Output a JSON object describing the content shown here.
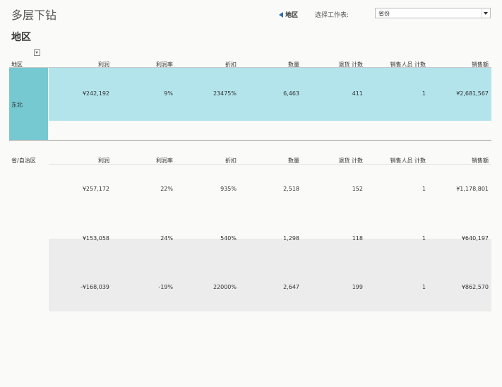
{
  "title": "多层下钻",
  "back_button_label": "地区",
  "sheet_selector": {
    "label": "选择工作表:",
    "value": "省份"
  },
  "section_title": "地区",
  "top_table": {
    "row_header": "地区",
    "columns": [
      "利润",
      "利润率",
      "折扣",
      "数量",
      "退货 计数",
      "销售人员 计数",
      "销售额"
    ],
    "rows": [
      {
        "region": "东北",
        "values": [
          "¥242,192",
          "9%",
          "23475%",
          "6,463",
          "411",
          "1",
          "¥2,681,567"
        ]
      }
    ]
  },
  "bottom_table": {
    "row_header": "省/自治区",
    "columns": [
      "利润",
      "利润率",
      "折扣",
      "数量",
      "退货 计数",
      "销售人员 计数",
      "销售额"
    ],
    "rows": [
      {
        "values": [
          "¥257,172",
          "22%",
          "935%",
          "2,518",
          "152",
          "1",
          "¥1,178,801"
        ]
      },
      {
        "values": [
          "¥153,058",
          "24%",
          "540%",
          "1,298",
          "118",
          "1",
          "¥640,197"
        ]
      },
      {
        "values": [
          "-¥168,039",
          "-19%",
          "22000%",
          "2,647",
          "199",
          "1",
          "¥862,570"
        ]
      }
    ]
  },
  "colors": {
    "selected_row": "#b3e4ec",
    "selected_header": "#76c9d1",
    "accent": "#2a6fa8"
  }
}
